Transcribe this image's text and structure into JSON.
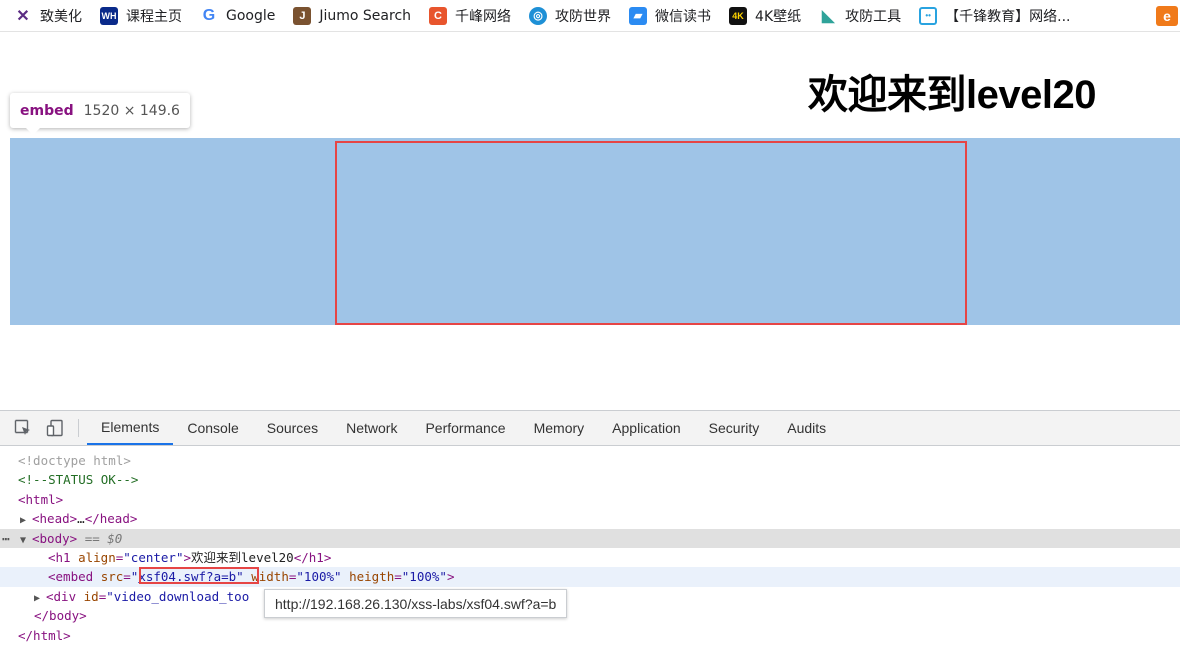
{
  "bookmarks": [
    {
      "label": "致美化",
      "icon": "x-icon",
      "color": "#5b2c83"
    },
    {
      "label": "课程主页",
      "icon": "wh-icon",
      "color": "#0a2a8a"
    },
    {
      "label": "Google",
      "icon": "google-icon",
      "color": "#4285f4"
    },
    {
      "label": "Jiumo Search",
      "icon": "j-icon",
      "color": "#7a5230"
    },
    {
      "label": "千峰网络",
      "icon": "c-icon",
      "color": "#e8552d"
    },
    {
      "label": "攻防世界",
      "icon": "globe-icon",
      "color": "#1e90d6"
    },
    {
      "label": "微信读书",
      "icon": "book-icon",
      "color": "#2b8bf2"
    },
    {
      "label": "4K壁纸",
      "icon": "4k-icon",
      "color": "#111111"
    },
    {
      "label": "攻防工具",
      "icon": "shield-icon",
      "color": "#2fa39a"
    },
    {
      "label": "【千锋教育】网络...",
      "icon": "tv-icon",
      "color": "#29a3e0"
    }
  ],
  "extension_icon": "e-icon",
  "page": {
    "title": "欢迎来到level20"
  },
  "inspect_tooltip": {
    "tag": "embed",
    "dimensions": "1520 × 149.6"
  },
  "devtools": {
    "tabs": [
      "Elements",
      "Console",
      "Sources",
      "Network",
      "Performance",
      "Memory",
      "Application",
      "Security",
      "Audits"
    ],
    "active_tab": "Elements",
    "dom": {
      "doctype": "<!doctype html>",
      "comment": "<!--STATUS OK-->",
      "html_open": "<html>",
      "head_open": "<head>",
      "head_ellipsis": "…",
      "head_close": "</head>",
      "body_open": "<body>",
      "body_marker": "== $0",
      "h1_open": "<h1",
      "h1_attr": "align",
      "h1_val": "\"center\"",
      "h1_text": "欢迎来到level20",
      "h1_close": "</h1>",
      "embed_open": "<embed",
      "embed_src_attr": "src",
      "embed_src_val": "xsf04.swf?a=b",
      "embed_width_attr": "width",
      "embed_width_val": "\"100%\"",
      "embed_heigth_attr": "heigth",
      "embed_heigth_val": "\"100%\"",
      "div_open": "<div",
      "div_attr": "id",
      "div_val": "\"video_download_too",
      "body_close": "</body>",
      "html_close": "</html>"
    },
    "url_tooltip": "http://192.168.26.130/xss-labs/xsf04.swf?a=b"
  }
}
